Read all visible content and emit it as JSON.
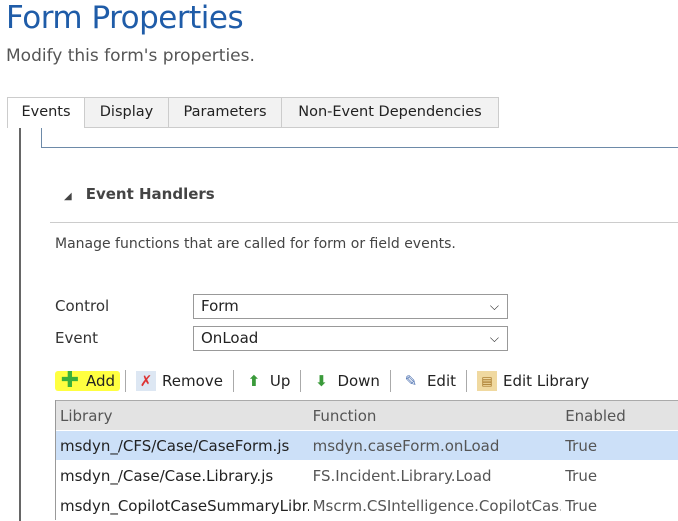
{
  "header": {
    "title": "Form Properties",
    "subtitle": "Modify this form's properties."
  },
  "tabs": [
    {
      "label": "Events"
    },
    {
      "label": "Display"
    },
    {
      "label": "Parameters"
    },
    {
      "label": "Non-Event Dependencies"
    }
  ],
  "section": {
    "title": "Event Handlers",
    "description": "Manage functions that are called for form or field events."
  },
  "fields": {
    "control_label": "Control",
    "control_value": "Form",
    "event_label": "Event",
    "event_value": "OnLoad"
  },
  "toolbar": {
    "add": "Add",
    "remove": "Remove",
    "up": "Up",
    "down": "Down",
    "edit": "Edit",
    "edit_library": "Edit Library"
  },
  "table": {
    "columns": [
      "Library",
      "Function",
      "Enabled"
    ],
    "rows": [
      [
        "msdyn_/CFS/Case/CaseForm.js",
        "msdyn.caseForm.onLoad",
        "True"
      ],
      [
        "msdyn_/Case/Case.Library.js",
        "FS.Incident.Library.Load",
        "True"
      ],
      [
        "msdyn_CopilotCaseSummaryLibr...",
        "Mscrm.CSIntelligence.CopilotCas...",
        "True"
      ]
    ]
  },
  "colors": {
    "title": "#1f5ca8",
    "selected_row": "#cce0f8",
    "highlight": "#ffff40"
  }
}
